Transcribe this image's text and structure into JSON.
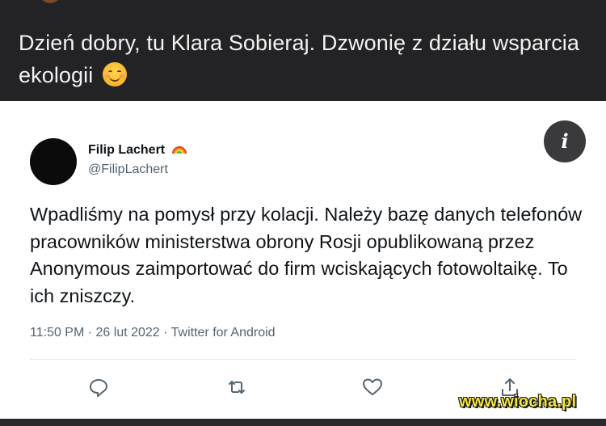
{
  "post": {
    "caption": "Dzień dobry, tu Klara Sobieraj. Dzwonię z działu wsparcia ekologii",
    "caption_emoji": "smiling-face-emoji"
  },
  "tweet": {
    "author_name": "Filip Lachert",
    "author_handle": "@FilipLachert",
    "text": "Wpadliśmy na pomysł przy kolacji. Należy bazę danych telefonów pracowników ministerstwa obrony Rosji opublikowaną przez Anonymous zaimportować do firm wciskających fotowoltaikę. To ich zniszczy.",
    "meta": "11:50 PM · 26 lut 2022 · Twitter for Android",
    "info_symbol": "i",
    "actions": [
      "reply-icon",
      "retweet-icon",
      "like-icon",
      "share-icon"
    ]
  },
  "watermark": "www.wiocha.pl",
  "colors": {
    "background_dark": "#232325",
    "card": "#ffffff",
    "text_primary": "#0f1419",
    "text_secondary": "#536471",
    "watermark": "#f5e63a"
  }
}
